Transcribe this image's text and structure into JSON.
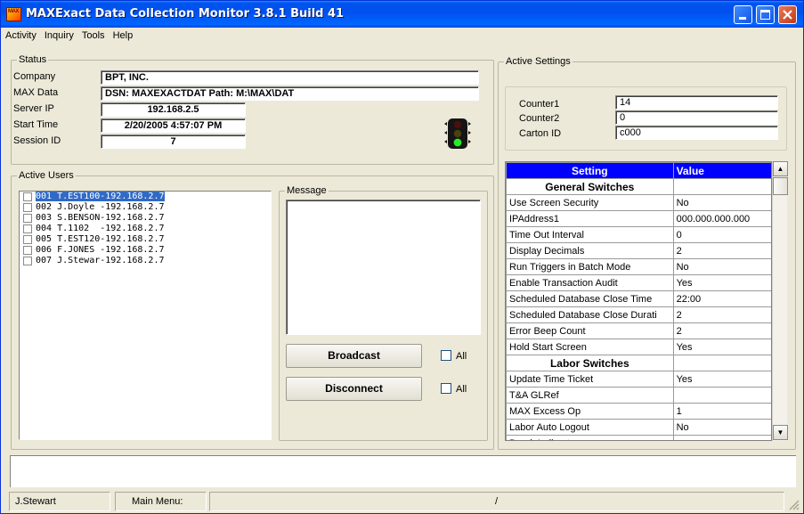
{
  "window": {
    "title": "MAXExact Data Collection Monitor  3.8.1 Build 41",
    "icon_text": "MAX"
  },
  "menu": [
    "Activity",
    "Inquiry",
    "Tools",
    "Help"
  ],
  "status": {
    "group_label": "Status",
    "company_label": "Company",
    "company": "BPT, INC.",
    "maxdata_label": "MAX Data",
    "maxdata": "DSN: MAXEXACTDAT Path: M:\\MAX\\DAT",
    "server_ip_label": "Server IP",
    "server_ip": "192.168.2.5",
    "start_time_label": "Start Time",
    "start_time": "2/20/2005 4:57:07 PM",
    "session_id_label": "Session ID",
    "session_id": "7",
    "traffic_light_icon": "traffic-light-green-icon"
  },
  "active_users": {
    "group_label": "Active Users",
    "users": [
      "001 T.EST100-192.168.2.7",
      "002 J.Doyle -192.168.2.7",
      "003 S.BENSON-192.168.2.7",
      "004 T.1102  -192.168.2.7",
      "005 T.EST120-192.168.2.7",
      "006 F.JONES -192.168.2.7",
      "007 J.Stewar-192.168.2.7"
    ],
    "selected_index": 0
  },
  "message": {
    "group_label": "Message",
    "text": ""
  },
  "buttons": {
    "broadcast": "Broadcast",
    "disconnect": "Disconnect",
    "all_label": "All"
  },
  "active_settings": {
    "group_label": "Active Settings",
    "counter1_label": "Counter1",
    "counter1": "14",
    "counter2_label": "Counter2",
    "counter2": "0",
    "carton_label": "Carton ID",
    "carton": "c000"
  },
  "settings_grid": {
    "headers": [
      "Setting",
      "Value"
    ],
    "rows": [
      {
        "section": "General Switches"
      },
      {
        "setting": "Use Screen Security",
        "value": "No"
      },
      {
        "setting": "IPAddress1",
        "value": "000.000.000.000"
      },
      {
        "setting": "Time Out Interval",
        "value": "0"
      },
      {
        "setting": "Display Decimals",
        "value": "2"
      },
      {
        "setting": "Run Triggers in Batch Mode",
        "value": "No"
      },
      {
        "setting": "Enable Transaction Audit",
        "value": "Yes"
      },
      {
        "setting": "Scheduled Database Close Time",
        "value": "22:00"
      },
      {
        "setting": "Scheduled Database Close Durati",
        "value": "2"
      },
      {
        "setting": "Error Beep Count",
        "value": "2"
      },
      {
        "setting": "Hold Start Screen",
        "value": "Yes"
      },
      {
        "section": "Labor Switches"
      },
      {
        "setting": "Update Time Ticket",
        "value": "Yes"
      },
      {
        "setting": "T&A GLRef",
        "value": ""
      },
      {
        "setting": "MAX Excess Op",
        "value": "1"
      },
      {
        "setting": "Labor Auto Logout",
        "value": "No"
      },
      {
        "setting": "Break Indirect",
        "value": ""
      }
    ]
  },
  "statusbar": {
    "user": "J.Stewart",
    "menu": "Main Menu:",
    "center": "/"
  }
}
